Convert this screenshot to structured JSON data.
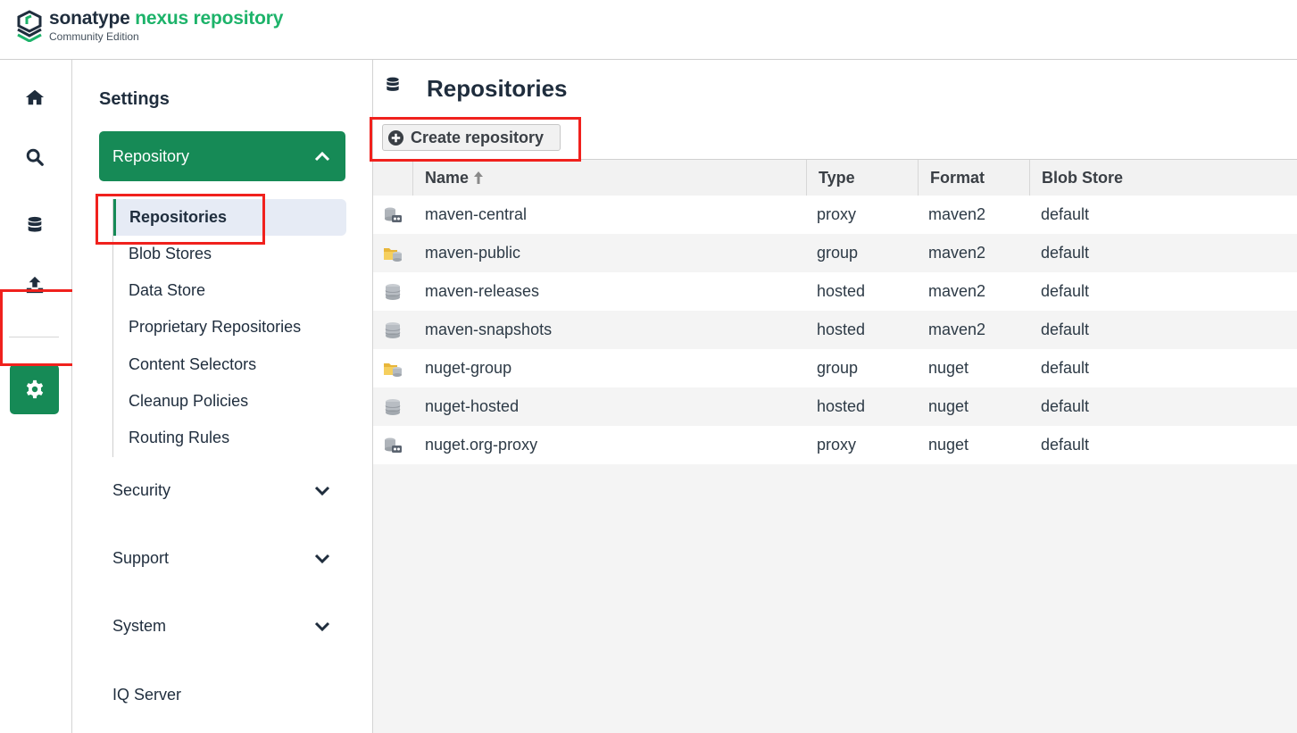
{
  "app": {
    "brand": "sonatype",
    "product": "nexus repository",
    "edition": "Community Edition",
    "colors": {
      "accent": "#168a56",
      "brand_green": "#1db36a",
      "highlight": "#f0211d"
    }
  },
  "rail": {
    "items": [
      {
        "name": "home",
        "icon": "home-icon"
      },
      {
        "name": "search",
        "icon": "search-icon"
      },
      {
        "name": "browse",
        "icon": "database-icon"
      },
      {
        "name": "upload",
        "icon": "upload-icon"
      },
      {
        "name": "settings",
        "icon": "gear-icon",
        "active": true
      }
    ]
  },
  "nav": {
    "title": "Settings",
    "active_group": {
      "label": "Repository",
      "expanded": true
    },
    "sub_items": [
      {
        "label": "Repositories",
        "active": true
      },
      {
        "label": "Blob Stores"
      },
      {
        "label": "Data Store"
      },
      {
        "label": "Proprietary Repositories"
      },
      {
        "label": "Content Selectors"
      },
      {
        "label": "Cleanup Policies"
      },
      {
        "label": "Routing Rules"
      }
    ],
    "groups": [
      {
        "label": "Security"
      },
      {
        "label": "Support"
      },
      {
        "label": "System"
      },
      {
        "label": "IQ Server"
      }
    ]
  },
  "main": {
    "title": "Repositories",
    "create_label": "Create repository",
    "columns": [
      "Name",
      "Type",
      "Format",
      "Blob Store"
    ],
    "sort_column": "Name",
    "rows": [
      {
        "name": "maven-central",
        "type": "proxy",
        "format": "maven2",
        "blob": "default",
        "icon": "proxy-repo-icon"
      },
      {
        "name": "maven-public",
        "type": "group",
        "format": "maven2",
        "blob": "default",
        "icon": "group-repo-icon"
      },
      {
        "name": "maven-releases",
        "type": "hosted",
        "format": "maven2",
        "blob": "default",
        "icon": "hosted-repo-icon"
      },
      {
        "name": "maven-snapshots",
        "type": "hosted",
        "format": "maven2",
        "blob": "default",
        "icon": "hosted-repo-icon"
      },
      {
        "name": "nuget-group",
        "type": "group",
        "format": "nuget",
        "blob": "default",
        "icon": "group-repo-icon"
      },
      {
        "name": "nuget-hosted",
        "type": "hosted",
        "format": "nuget",
        "blob": "default",
        "icon": "hosted-repo-icon"
      },
      {
        "name": "nuget.org-proxy",
        "type": "proxy",
        "format": "nuget",
        "blob": "default",
        "icon": "proxy-repo-icon"
      }
    ]
  }
}
